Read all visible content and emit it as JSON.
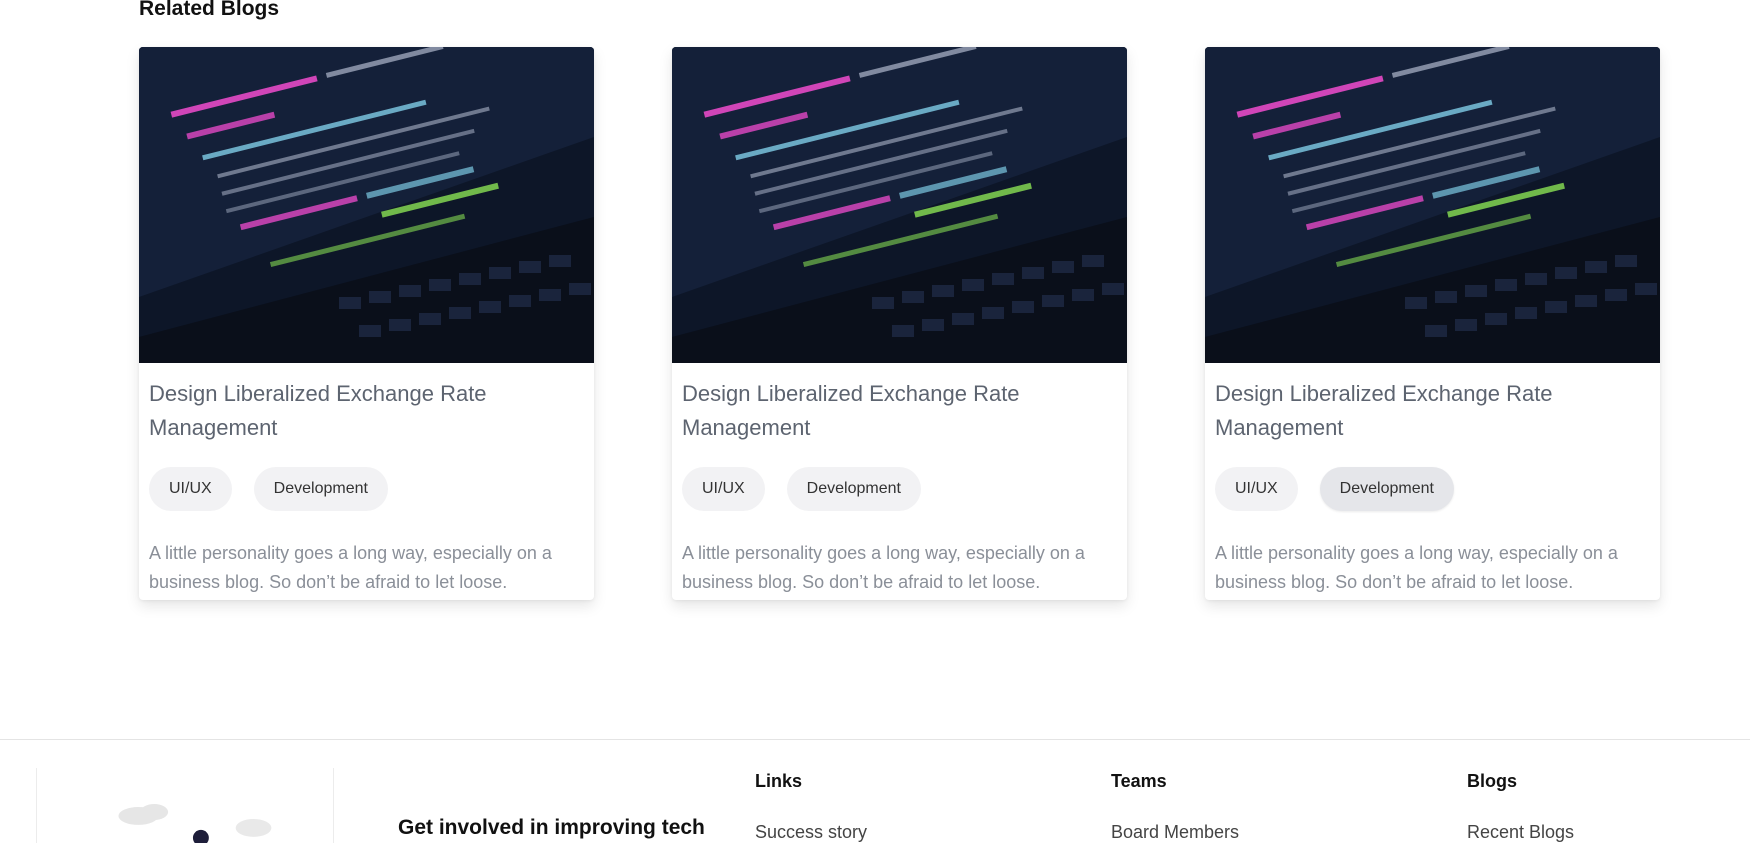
{
  "section": {
    "title": "Related Blogs"
  },
  "cards": [
    {
      "title": "Design Liberalized Exchange Rate Management",
      "tags": [
        "UI/UX",
        "Development"
      ],
      "description": "A little personality goes a long way, especially on a business blog. So don’t be afraid to let loose."
    },
    {
      "title": "Design Liberalized Exchange Rate Management",
      "tags": [
        "UI/UX",
        "Development"
      ],
      "description": "A little personality goes a long way, especially on a business blog. So don’t be afraid to let loose."
    },
    {
      "title": "Design Liberalized Exchange Rate Management",
      "tags": [
        "UI/UX",
        "Development"
      ],
      "description": "A little personality goes a long way, especially on a business blog. So don’t be afraid to let loose."
    }
  ],
  "footer": {
    "tagline": "Get involved in improving tech",
    "columns": [
      {
        "heading": "Links",
        "items": [
          "Success story"
        ]
      },
      {
        "heading": "Teams",
        "items": [
          "Board Members"
        ]
      },
      {
        "heading": "Blogs",
        "items": [
          "Recent Blogs"
        ]
      }
    ]
  },
  "colors": {
    "card_image_bg": "#0d1628",
    "tag_bg": "#f2f2f4",
    "code_pink": "#ff4fd8",
    "code_green": "#9cff5a"
  }
}
